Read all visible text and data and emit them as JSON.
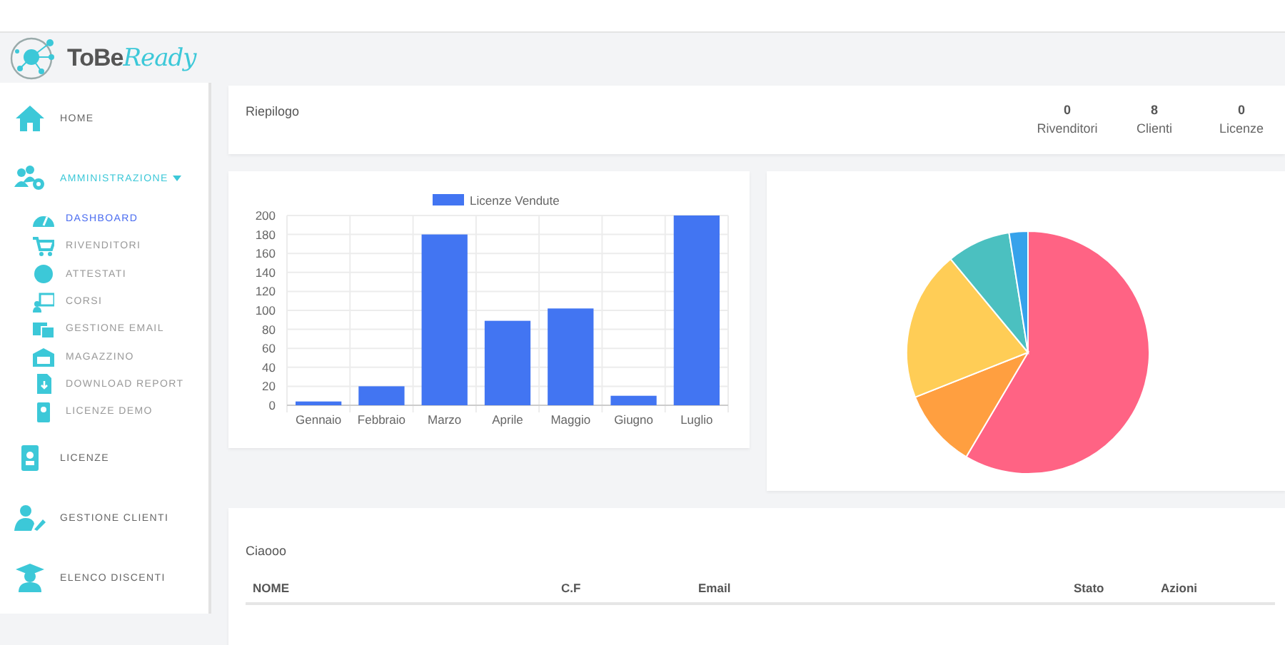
{
  "logo": {
    "brand": "ToBe",
    "brand_accent": "Ready"
  },
  "sidebar": {
    "items": [
      {
        "label": "HOME",
        "selected": false
      },
      {
        "label": "AMMINISTRAZIONE",
        "selected": false,
        "expanded": true,
        "children": [
          {
            "label": "DASHBOARD",
            "selected": true
          },
          {
            "label": "RIVENDITORI",
            "selected": false
          },
          {
            "label": "ATTESTATI",
            "selected": false
          },
          {
            "label": "CORSI",
            "selected": false
          },
          {
            "label": "GESTIONE EMAIL",
            "selected": false
          },
          {
            "label": "MAGAZZINO",
            "selected": false
          },
          {
            "label": "DOWNLOAD REPORT",
            "selected": false
          },
          {
            "label": "LICENZE DEMO",
            "selected": false
          }
        ]
      },
      {
        "label": "LICENZE",
        "selected": false
      },
      {
        "label": "GESTIONE CLIENTI",
        "selected": false
      },
      {
        "label": "ELENCO DISCENTI",
        "selected": false
      }
    ]
  },
  "summary": {
    "title": "Riepilogo",
    "stats": [
      {
        "value": "0",
        "label": "Rivenditori"
      },
      {
        "value": "8",
        "label": "Clienti"
      },
      {
        "value": "0",
        "label": "Licenze"
      }
    ]
  },
  "bar_chart": {
    "chart_data": {
      "type": "bar",
      "grid": true,
      "categories": [
        "Gennaio",
        "Febbraio",
        "Marzo",
        "Aprile",
        "Maggio",
        "Giugno",
        "Luglio"
      ],
      "series": [
        {
          "name": "Licenze Vendute",
          "color": "#4275f2",
          "values": [
            4,
            20,
            180,
            89,
            102,
            10,
            200
          ]
        }
      ],
      "ylim": [
        0,
        200
      ],
      "yticks": [
        0,
        20,
        40,
        60,
        80,
        100,
        120,
        140,
        160,
        180,
        200
      ]
    }
  },
  "table": {
    "title": "Ciaooo",
    "columns": [
      "NOME",
      "C.F",
      "Email",
      "Stato",
      "Azioni"
    ]
  }
}
